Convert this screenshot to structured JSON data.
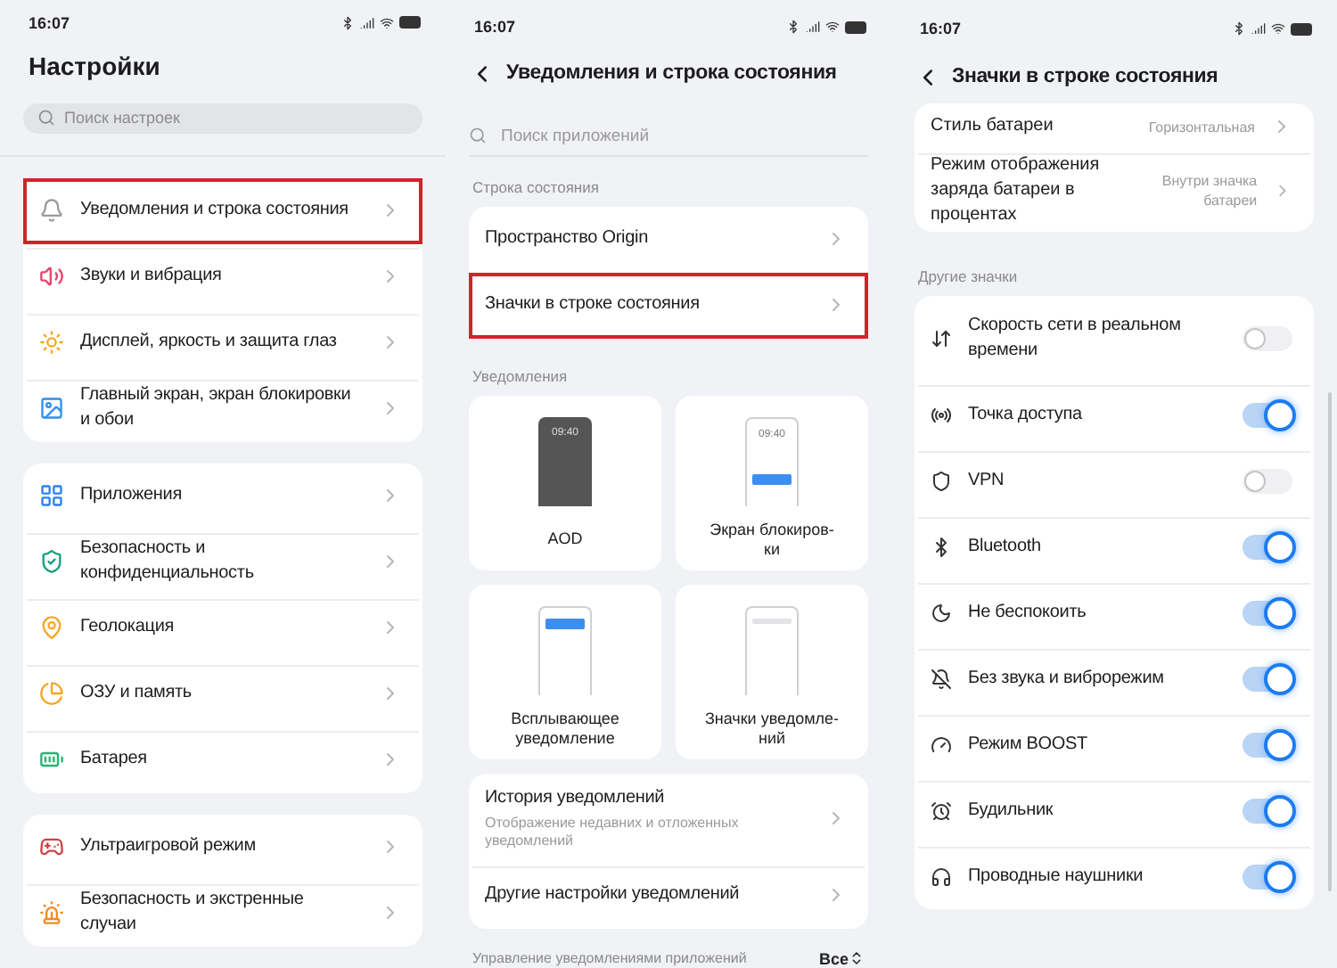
{
  "settings_screen": {
    "status_time": "16:07",
    "title": "Настройки",
    "search": {
      "placeholder": "Поиск настроек"
    },
    "groups": [
      [
        {
          "label": "Уведомления и строка состояния",
          "highlighted": true
        },
        {
          "label": "Звуки и вибрация",
          "highlighted": false
        },
        {
          "label": "Дисплей, яркость и защита глаз",
          "highlighted": false
        },
        {
          "label": "Главный экран, экран блокировки и обои",
          "highlighted": false
        }
      ],
      [
        {
          "label": "Приложения",
          "highlighted": false
        },
        {
          "label": "Безопасность и конфиденциальность",
          "highlighted": false
        },
        {
          "label": "Геолокация",
          "highlighted": false
        },
        {
          "label": "ОЗУ и память",
          "highlighted": false
        },
        {
          "label": "Батарея",
          "highlighted": false
        }
      ],
      [
        {
          "label": "Ультраигровой режим",
          "highlighted": false
        },
        {
          "label": "Безопасность и экстренные случаи",
          "highlighted": false
        }
      ]
    ]
  },
  "notifications_screen": {
    "status_time": "16:07",
    "title": "Уведомления и строка состояния",
    "search": {
      "placeholder": "Поиск приложений"
    },
    "section_status": "Строка состояния",
    "status_items": [
      {
        "label": "Пространство Origin",
        "highlighted": false
      },
      {
        "label": "Значки в строке состояния",
        "highlighted": true
      }
    ],
    "section_notifications": "Уведомления",
    "tiles": [
      {
        "kind": "aod",
        "label": "AOD",
        "screen_time": "09:40"
      },
      {
        "kind": "lock",
        "label": "Экран блокиров-\nки",
        "screen_time": "09:40"
      },
      {
        "kind": "popup",
        "label": "Всплывающее\nуведомление"
      },
      {
        "kind": "icons",
        "label": "Значки уведомле-\nний"
      }
    ],
    "more_items": [
      {
        "title": "История уведомлений",
        "subtitle": "Отображение недавних и отложенных уведомлений"
      },
      {
        "title": "Другие настройки уведомлений"
      }
    ],
    "footer": {
      "label": "Управление уведомлениями приложений",
      "value": "Все"
    }
  },
  "status_icons_screen": {
    "status_time": "16:07",
    "title": "Значки в строке состояния",
    "battery_items": [
      {
        "label": "Стиль батареи",
        "value": "Горизонтальная"
      },
      {
        "label": "Режим отображения заряда батареи в процентах",
        "value": "Внутри значка батареи"
      }
    ],
    "section": "Другие значки",
    "toggles": [
      {
        "label": "Скорость сети в реальном времени",
        "on": false
      },
      {
        "label": "Точка доступа",
        "on": true
      },
      {
        "label": "VPN",
        "on": false
      },
      {
        "label": "Bluetooth",
        "on": true
      },
      {
        "label": "Не беспокоить",
        "on": true
      },
      {
        "label": "Без звука и виброрежим",
        "on": true
      },
      {
        "label": "Режим BOOST",
        "on": true
      },
      {
        "label": "Будильник",
        "on": true
      },
      {
        "label": "Проводные наушники",
        "on": true
      }
    ]
  }
}
